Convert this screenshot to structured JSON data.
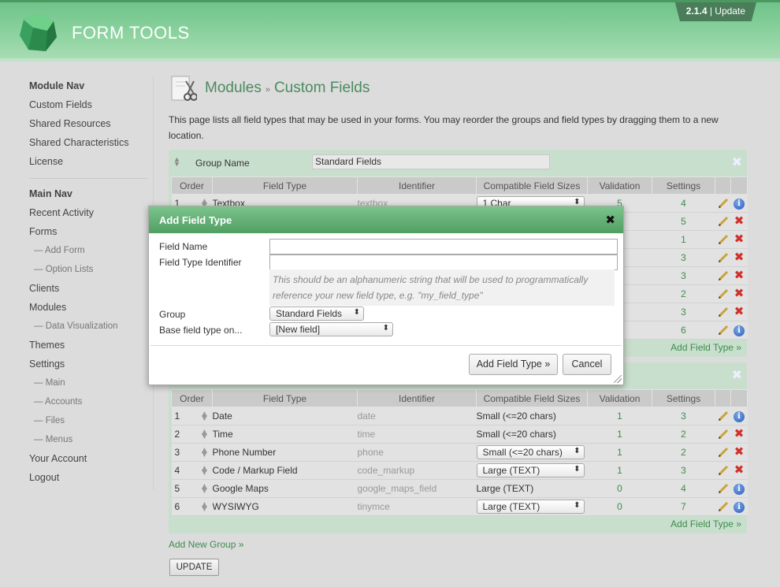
{
  "header": {
    "logo_text": "FORM TOOLS",
    "version": "2.1.4",
    "update_label": "Update"
  },
  "nav": {
    "module_nav_title": "Module Nav",
    "module_items": [
      "Custom Fields",
      "Shared Resources",
      "Shared Characteristics",
      "License"
    ],
    "main_nav_title": "Main Nav",
    "main_items": [
      {
        "label": "Recent Activity",
        "sub": false
      },
      {
        "label": "Forms",
        "sub": false
      },
      {
        "label": "— Add Form",
        "sub": true
      },
      {
        "label": "— Option Lists",
        "sub": true
      },
      {
        "label": "Clients",
        "sub": false
      },
      {
        "label": "Modules",
        "sub": false
      },
      {
        "label": "— Data Visualization",
        "sub": true
      },
      {
        "label": "Themes",
        "sub": false
      },
      {
        "label": "Settings",
        "sub": false
      },
      {
        "label": "— Main",
        "sub": true
      },
      {
        "label": "— Accounts",
        "sub": true
      },
      {
        "label": "— Files",
        "sub": true
      },
      {
        "label": "— Menus",
        "sub": true
      },
      {
        "label": "Your Account",
        "sub": false
      },
      {
        "label": "Logout",
        "sub": false
      }
    ]
  },
  "page": {
    "title_part1": "Modules",
    "title_sep": "»",
    "title_part2": "Custom Fields",
    "intro": "This page lists all field types that may be used in your forms. You may reorder the groups and field types by dragging them to a new location.",
    "add_group": "Add New Group »",
    "update_btn": "UPDATE"
  },
  "columns": [
    "Order",
    "Field Type",
    "Identifier",
    "Compatible Field Sizes",
    "Validation",
    "Settings"
  ],
  "group1": {
    "label": "Group Name",
    "name": "Standard Fields",
    "add_link": "Add Field Type »",
    "rows": [
      {
        "order": "1",
        "type": "Textbox",
        "ident": "textbox",
        "size": "1 Char",
        "size_select": true,
        "validation": "5",
        "settings": "4",
        "action": "info"
      },
      {
        "order": "",
        "type": "",
        "ident": "",
        "size": "",
        "size_select": false,
        "validation": "",
        "settings": "5",
        "action": "del"
      },
      {
        "order": "",
        "type": "",
        "ident": "",
        "size": "",
        "size_select": false,
        "validation": "",
        "settings": "1",
        "action": "del"
      },
      {
        "order": "",
        "type": "",
        "ident": "",
        "size": "",
        "size_select": false,
        "validation": "",
        "settings": "3",
        "action": "del"
      },
      {
        "order": "",
        "type": "",
        "ident": "",
        "size": "",
        "size_select": false,
        "validation": "",
        "settings": "3",
        "action": "del"
      },
      {
        "order": "",
        "type": "",
        "ident": "",
        "size": "",
        "size_select": false,
        "validation": "",
        "settings": "2",
        "action": "del"
      },
      {
        "order": "",
        "type": "",
        "ident": "",
        "size": "",
        "size_select": false,
        "validation": "",
        "settings": "3",
        "action": "del"
      },
      {
        "order": "",
        "type": "",
        "ident": "",
        "size": "",
        "size_select": false,
        "validation": "",
        "settings": "6",
        "action": "info"
      }
    ]
  },
  "group2": {
    "add_link": "Add Field Type »",
    "rows": [
      {
        "order": "1",
        "type": "Date",
        "ident": "date",
        "size": "Small (<=20 chars)",
        "size_select": false,
        "validation": "1",
        "settings": "3",
        "action": "info"
      },
      {
        "order": "2",
        "type": "Time",
        "ident": "time",
        "size": "Small (<=20 chars)",
        "size_select": false,
        "validation": "1",
        "settings": "2",
        "action": "del"
      },
      {
        "order": "3",
        "type": "Phone Number",
        "ident": "phone",
        "size": "Small (<=20 chars)",
        "size_select": true,
        "validation": "1",
        "settings": "2",
        "action": "del"
      },
      {
        "order": "4",
        "type": "Code / Markup Field",
        "ident": "code_markup",
        "size": "Large (TEXT)",
        "size_select": true,
        "validation": "1",
        "settings": "3",
        "action": "del"
      },
      {
        "order": "5",
        "type": "Google Maps",
        "ident": "google_maps_field",
        "size": "Large (TEXT)",
        "size_select": false,
        "validation": "0",
        "settings": "4",
        "action": "info"
      },
      {
        "order": "6",
        "type": "WYSIWYG",
        "ident": "tinymce",
        "size": "Large (TEXT)",
        "size_select": true,
        "validation": "0",
        "settings": "7",
        "action": "info"
      }
    ]
  },
  "modal": {
    "title": "Add Field Type",
    "field_name_label": "Field Name",
    "identifier_label": "Field Type Identifier",
    "hint": "This should be an alphanumeric string that will be used to programmatically reference your new field type, e.g. \"my_field_type\"",
    "group_label": "Group",
    "group_value": "Standard Fields",
    "base_label": "Base field type on...",
    "base_value": "[New field]",
    "add_btn": "Add Field Type »",
    "cancel_btn": "Cancel"
  },
  "colors": {
    "accent": "#4a8b5e",
    "link": "#3e8c4f",
    "delete": "#d0302b",
    "header": "#8ed3a0"
  }
}
